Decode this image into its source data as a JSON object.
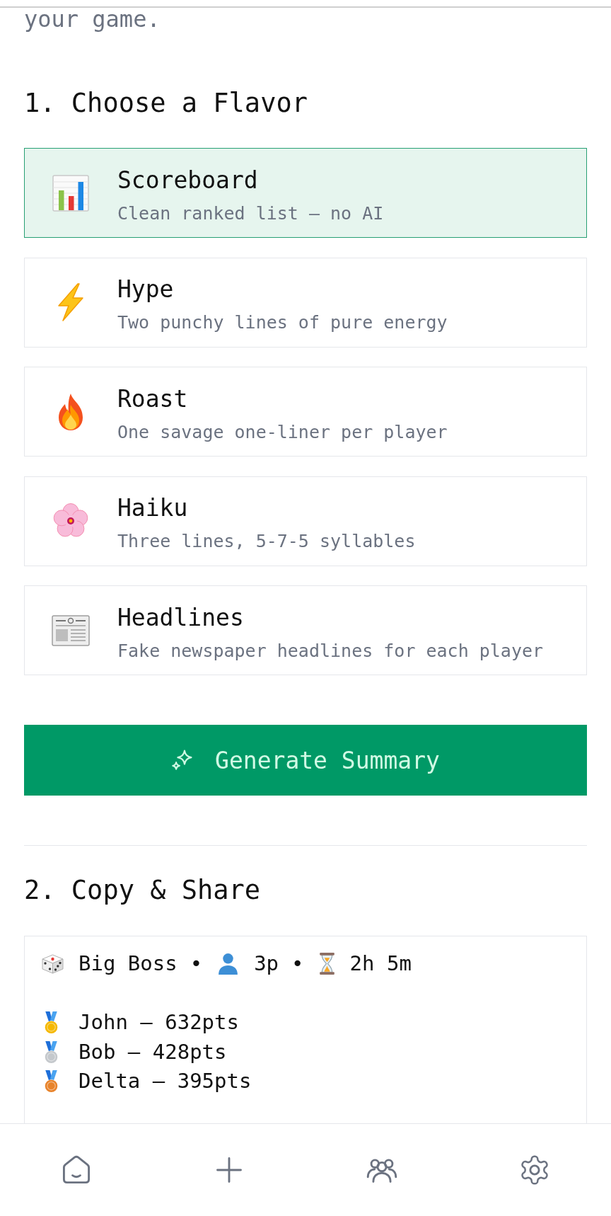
{
  "intro": "your game.",
  "flavor_section": {
    "heading": "1. Choose a Flavor",
    "flavors": [
      {
        "title": "Scoreboard",
        "description": "Clean ranked list — no AI",
        "selected": true
      },
      {
        "title": "Hype",
        "description": "Two punchy lines of pure energy",
        "selected": false
      },
      {
        "title": "Roast",
        "description": "One savage one-liner per player",
        "selected": false
      },
      {
        "title": "Haiku",
        "description": "Three lines, 5-7-5 syllables",
        "selected": false
      },
      {
        "title": "Headlines",
        "description": "Fake newspaper headlines for each player",
        "selected": false
      }
    ]
  },
  "generate_button": {
    "label": "Generate Summary"
  },
  "share_section": {
    "heading": "2. Copy & Share",
    "summary": {
      "header": [
        {
          "kind": "game",
          "text": "Big Boss"
        },
        {
          "kind": "separator",
          "text": "•"
        },
        {
          "kind": "players",
          "text": "3p"
        },
        {
          "kind": "separator",
          "text": "•"
        },
        {
          "kind": "duration",
          "text": "2h 5m"
        }
      ],
      "rankings": [
        {
          "text": "John — 632pts",
          "color": "#f5b800"
        },
        {
          "text": "Bob — 428pts",
          "color": "#c4c8cc"
        },
        {
          "text": "Delta — 395pts",
          "color": "#e8832a"
        }
      ]
    }
  },
  "bottom_nav": [
    {
      "selected": false
    },
    {
      "selected": false
    },
    {
      "selected": false
    },
    {
      "selected": false
    }
  ]
}
